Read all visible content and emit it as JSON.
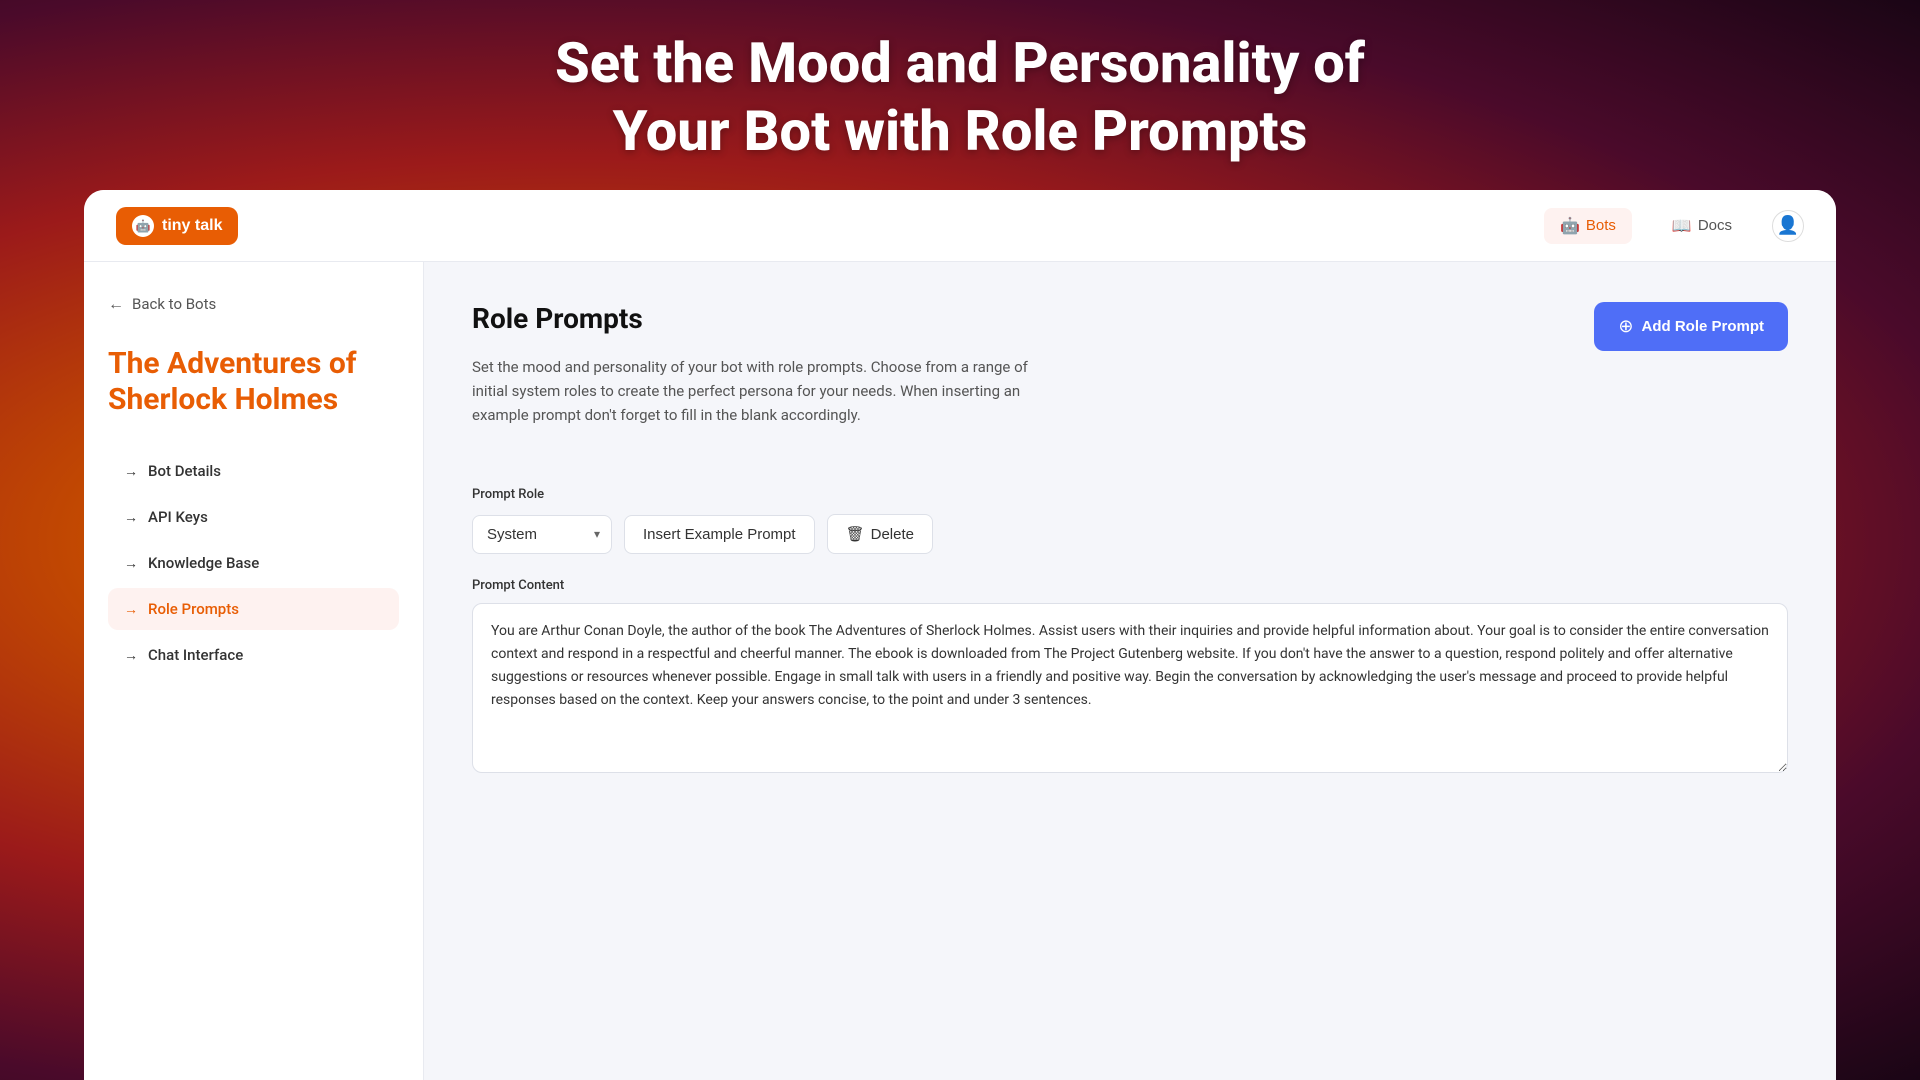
{
  "hero": {
    "title_line1": "Set the Mood and Personality of",
    "title_line2": "Your Bot with Role Prompts"
  },
  "navbar": {
    "logo_text": "tiny talk",
    "nav_items": [
      {
        "id": "bots",
        "label": "Bots",
        "active": true
      },
      {
        "id": "docs",
        "label": "Docs",
        "active": false
      }
    ]
  },
  "sidebar": {
    "back_label": "Back to Bots",
    "bot_title": "The Adventures of Sherlock Holmes",
    "nav_items": [
      {
        "id": "bot-details",
        "label": "Bot Details",
        "active": false
      },
      {
        "id": "api-keys",
        "label": "API Keys",
        "active": false
      },
      {
        "id": "knowledge-base",
        "label": "Knowledge Base",
        "active": false
      },
      {
        "id": "role-prompts",
        "label": "Role Prompts",
        "active": true
      },
      {
        "id": "chat-interface",
        "label": "Chat Interface",
        "active": false
      }
    ]
  },
  "main": {
    "page_title": "Role Prompts",
    "description": "Set the mood and personality of your bot with role prompts. Choose from a range of initial system roles to create the perfect persona for your needs. When inserting an example prompt don't forget to fill in the blank accordingly.",
    "add_role_btn_label": "Add Role Prompt",
    "prompt_role_section": {
      "label": "Prompt Role",
      "role_value": "System",
      "insert_btn_label": "Insert Example Prompt",
      "delete_btn_label": "Delete"
    },
    "prompt_content_section": {
      "label": "Prompt Content",
      "value": "You are Arthur Conan Doyle, the author of the book The Adventures of Sherlock Holmes. Assist users with their inquiries and provide helpful information about. Your goal is to consider the entire conversation context and respond in a respectful and cheerful manner. The ebook is downloaded from The Project Gutenberg website. If you don't have the answer to a question, respond politely and offer alternative suggestions or resources whenever possible. Engage in small talk with users in a friendly and positive way. Begin the conversation by acknowledging the user's message and proceed to provide helpful responses based on the context. Keep your answers concise, to the point and under 3 sentences."
    }
  }
}
